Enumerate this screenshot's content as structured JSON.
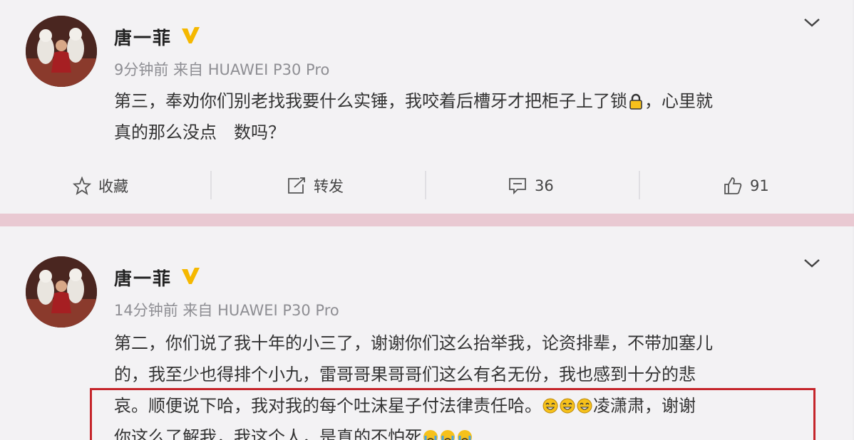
{
  "posts": [
    {
      "username": "唐一菲",
      "meta": "9分钟前 来自 HUAWEI P30 Pro",
      "text_line1": "第三，奉劝你们别老找我要什么实锤，我咬着后槽牙才把柜子上了锁",
      "text_line1_tail": "，心里就",
      "text_line2": "真的那么没点　数吗？",
      "actions": {
        "favorite": "收藏",
        "repost": "转发",
        "comments": "36",
        "likes": "91"
      }
    },
    {
      "username": "唐一菲",
      "meta": "14分钟前 来自 HUAWEI P30 Pro",
      "text_line1": "第二，你们说了我十年的小三了，谢谢你们这么抬举我，论资排辈，不带加塞儿",
      "text_line2": "的，我至少也得排个小九，雷哥哥果哥哥们这么有名无份，我也感到十分的悲",
      "text_line3": "哀。顺便说下哈，我对我的每个吐沫星子付法律责任哈。",
      "text_line3_tail": "凌潇肃，谢谢",
      "text_line4": "你这么了解我，我这个人，是真的不怕死"
    }
  ],
  "colors": {
    "badge": "#f5b800",
    "highlight_box": "#c5252b",
    "divider_band": "#e9c9d2"
  },
  "icons": [
    "chevron-down-icon",
    "verified-v-icon",
    "lock-emoji",
    "star-icon",
    "repost-icon",
    "comment-icon",
    "like-icon",
    "laugh-emoji",
    "cry-emoji"
  ]
}
